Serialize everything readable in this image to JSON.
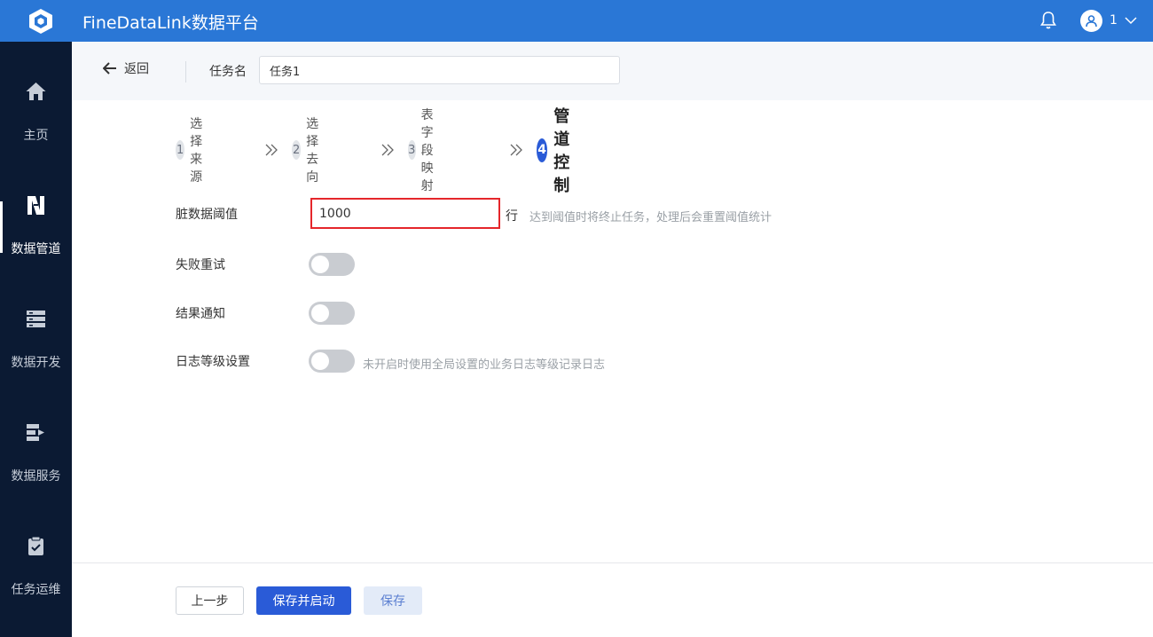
{
  "app": {
    "title": "FineDataLink数据平台",
    "user_name": "1"
  },
  "sidebar": {
    "items": [
      {
        "label": "主页",
        "icon": "home-icon",
        "active": false
      },
      {
        "label": "数据管道",
        "icon": "pipeline-icon",
        "active": true
      },
      {
        "label": "数据开发",
        "icon": "data-dev-icon",
        "active": false
      },
      {
        "label": "数据服务",
        "icon": "data-service-icon",
        "active": false
      },
      {
        "label": "任务运维",
        "icon": "task-ops-icon",
        "active": false
      }
    ]
  },
  "header": {
    "back_label": "返回",
    "task_name_label": "任务名",
    "task_name_value": "任务1"
  },
  "steps": [
    {
      "num": "1",
      "label": "选择来源"
    },
    {
      "num": "2",
      "label": "选择去向"
    },
    {
      "num": "3",
      "label": "表字段映射"
    },
    {
      "num": "4",
      "label": "管道控制"
    }
  ],
  "form": {
    "threshold": {
      "label": "脏数据阈值",
      "value": "1000",
      "unit": "行",
      "hint": "达到阈值时将终止任务，处理后会重置阈值统计"
    },
    "retry": {
      "label": "失败重试",
      "enabled": false
    },
    "notify": {
      "label": "结果通知",
      "enabled": false
    },
    "log_level": {
      "label": "日志等级设置",
      "enabled": false,
      "hint": "未开启时使用全局设置的业务日志等级记录日志"
    }
  },
  "footer": {
    "prev_label": "上一步",
    "save_start_label": "保存并启动",
    "save_label": "保存"
  },
  "colors": {
    "topbar": "#2a77d6",
    "sidebar": "#0b1a33",
    "primary": "#2a5bd7",
    "highlight_border": "#e5262b"
  }
}
